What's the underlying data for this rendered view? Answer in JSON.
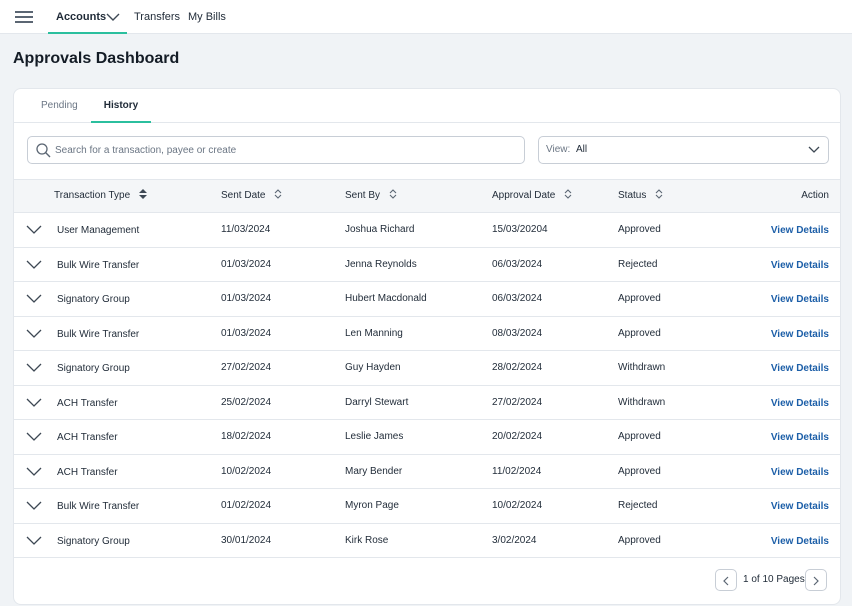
{
  "nav": {
    "menu_icon": "hamburger-icon",
    "items": [
      {
        "label": "Accounts",
        "active": true
      },
      {
        "label": "Transfers"
      },
      {
        "label": "My Bills"
      }
    ]
  },
  "page": {
    "title": "Approvals Dashboard"
  },
  "tabs": [
    {
      "label": "Pending"
    },
    {
      "label": "History",
      "active": true
    }
  ],
  "search": {
    "placeholder": "Search for a transaction, payee or create",
    "value": ""
  },
  "view": {
    "label": "View:",
    "value": "All"
  },
  "table": {
    "columns": [
      "Transaction Type",
      "Sent Date",
      "Sent By",
      "Approval Date",
      "Status",
      "Action"
    ],
    "rows": [
      {
        "type": "User Management",
        "sent": "11/03/2024",
        "by": "Joshua Richard",
        "approval": "15/03/20204",
        "status": "Approved",
        "action": "View Details"
      },
      {
        "type": "Bulk Wire Transfer",
        "sent": "01/03/2024",
        "by": "Jenna Reynolds",
        "approval": "06/03/2024",
        "status": "Rejected",
        "action": "View Details"
      },
      {
        "type": "Signatory Group",
        "sent": "01/03/2024",
        "by": "Hubert Macdonald",
        "approval": "06/03/2024",
        "status": "Approved",
        "action": "View Details"
      },
      {
        "type": "Bulk Wire Transfer",
        "sent": "01/03/2024",
        "by": "Len Manning",
        "approval": "08/03/2024",
        "status": "Approved",
        "action": "View Details"
      },
      {
        "type": "Signatory Group",
        "sent": "27/02/2024",
        "by": "Guy Hayden",
        "approval": "28/02/2024",
        "status": "Withdrawn",
        "action": "View Details"
      },
      {
        "type": "ACH Transfer",
        "sent": "25/02/2024",
        "by": "Darryl Stewart",
        "approval": "27/02/2024",
        "status": "Withdrawn",
        "action": "View Details"
      },
      {
        "type": "ACH Transfer",
        "sent": "18/02/2024",
        "by": "Leslie James",
        "approval": "20/02/2024",
        "status": "Approved",
        "action": "View Details"
      },
      {
        "type": "ACH Transfer",
        "sent": "10/02/2024",
        "by": "Mary Bender",
        "approval": "11/02/2024",
        "status": "Approved",
        "action": "View Details"
      },
      {
        "type": "Bulk Wire Transfer",
        "sent": "01/02/2024",
        "by": "Myron Page",
        "approval": "10/02/2024",
        "status": "Rejected",
        "action": "View Details"
      },
      {
        "type": "Signatory Group",
        "sent": "30/01/2024",
        "by": "Kirk Rose",
        "approval": "3/02/2024",
        "status": "Approved",
        "action": "View Details"
      }
    ]
  },
  "pagination": {
    "text": "1 of 10 Pages"
  },
  "colors": {
    "accent": "#2bbf9e",
    "link": "#1d5fa8",
    "background": "#f0f3f6"
  }
}
